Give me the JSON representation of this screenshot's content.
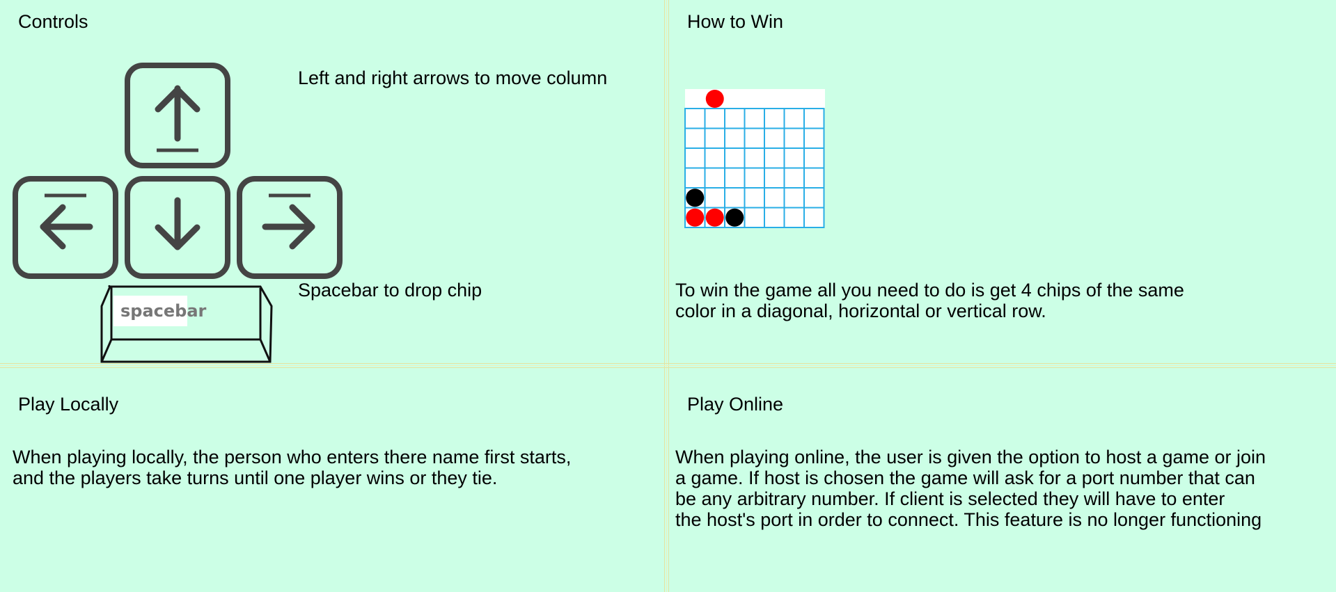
{
  "panels": {
    "controls": {
      "heading": "Controls",
      "arrows_text": "Left and right arrows to move column",
      "spacebar_text": "Spacebar to drop chip",
      "spacebar_key_label": "spacebar"
    },
    "how_to_win": {
      "heading": "How to Win",
      "lines": [
        "To win the game all you need to do is get 4 chips of the same",
        "color in a diagonal, horizontal or vertical row."
      ]
    },
    "play_locally": {
      "heading": "Play Locally",
      "lines": [
        "When playing locally, the person who enters there name first starts,",
        "and the players take turns until one player wins or they tie."
      ]
    },
    "play_online": {
      "heading": "Play Online",
      "lines": [
        "When playing online, the user is given the option to host a game or join",
        "a game. If host is chosen the game will ask for a port number that can",
        "be any arbitrary number. If client is selected they will have to enter",
        "the host's port in order to connect. This feature is no longer functioning"
      ]
    }
  },
  "icons": [
    "arrow-up-key-icon",
    "arrow-left-key-icon",
    "arrow-down-key-icon",
    "arrow-right-key-icon",
    "spacebar-key-icon"
  ],
  "board": {
    "columns": 7,
    "rows": 6,
    "pending_chip": {
      "column": 2,
      "color": "red"
    },
    "chips": [
      {
        "column": 1,
        "row": 5,
        "color": "black"
      },
      {
        "column": 1,
        "row": 6,
        "color": "red"
      },
      {
        "column": 2,
        "row": 6,
        "color": "red"
      },
      {
        "column": 3,
        "row": 6,
        "color": "black"
      }
    ]
  },
  "colors": {
    "background": "#ccffe6",
    "grid": "#29aee6",
    "red_chip": "#ff0000",
    "black_chip": "#000000",
    "key_stroke": "#444444"
  }
}
